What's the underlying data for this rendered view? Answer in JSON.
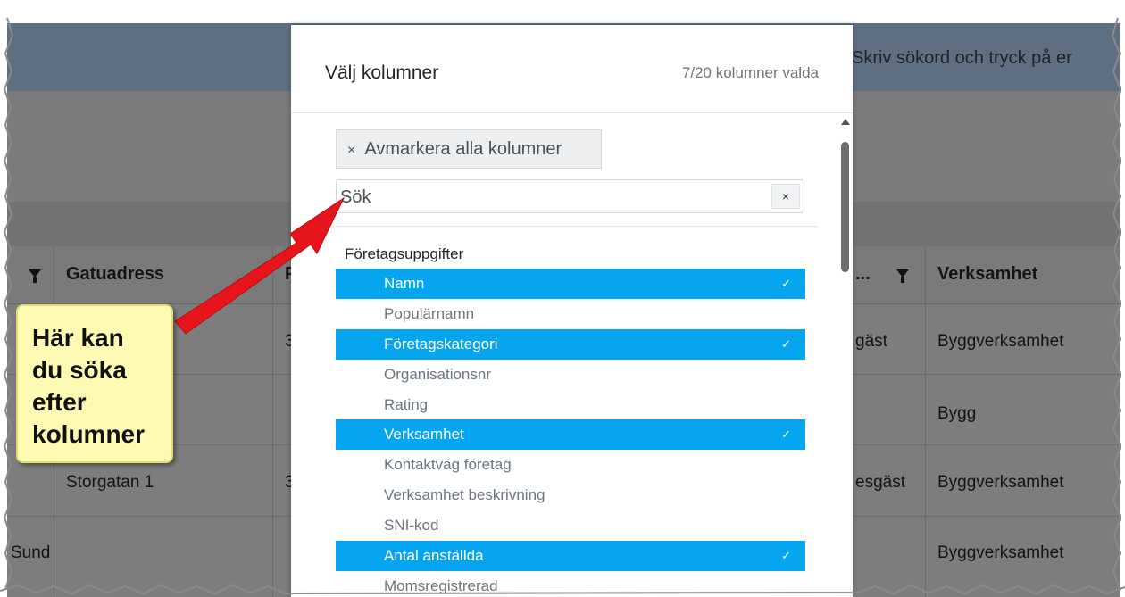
{
  "app": {
    "search_hint": "Skriv sökord och tryck på er",
    "grid": {
      "headers": {
        "col1_partial": "",
        "gatuadress": "Gatuadress",
        "col3_partial": "P",
        "col4_partial": "...",
        "verksamhet": "Verksamhet"
      },
      "rows": [
        {
          "gatuadress": "",
          "col3": "3",
          "col4": "gäst",
          "verksamhet": "Byggverksamhet"
        },
        {
          "gatuadress": "",
          "col3": "",
          "col4": "",
          "verksamhet": "Bygg"
        },
        {
          "gatuadress": "Storgatan 1",
          "col3": "3",
          "col4": "esgäst",
          "verksamhet": "Byggverksamhet"
        },
        {
          "col1": "Sund",
          "gatuadress": "",
          "col3": "",
          "col4": "",
          "verksamhet": "Byggverksamhet"
        }
      ]
    }
  },
  "modal": {
    "title": "Välj kolumner",
    "count": "7/20 kolumner valda",
    "deselect_all": "Avmarkera alla kolumner",
    "deselect_icon": "×",
    "search_placeholder": "Sök",
    "clear_icon": "×",
    "group_label": "Företagsuppgifter",
    "options": [
      {
        "label": "Namn",
        "selected": true
      },
      {
        "label": "Populärnamn",
        "selected": false
      },
      {
        "label": "Företagskategori",
        "selected": true
      },
      {
        "label": "Organisationsnr",
        "selected": false
      },
      {
        "label": "Rating",
        "selected": false
      },
      {
        "label": "Verksamhet",
        "selected": true
      },
      {
        "label": "Kontaktväg företag",
        "selected": false
      },
      {
        "label": "Verksamhet beskrivning",
        "selected": false
      },
      {
        "label": "SNI-kod",
        "selected": false
      },
      {
        "label": "Antal anställda",
        "selected": true
      },
      {
        "label": "Momsregistrerad",
        "selected": false
      }
    ],
    "check_icon": "✓"
  },
  "callout": {
    "text": "Här kan\ndu söka\nefter\nkolumner"
  },
  "colors": {
    "selected": "#06a5f0",
    "callout_bg": "#fffab3",
    "arrow": "#e8141b"
  }
}
